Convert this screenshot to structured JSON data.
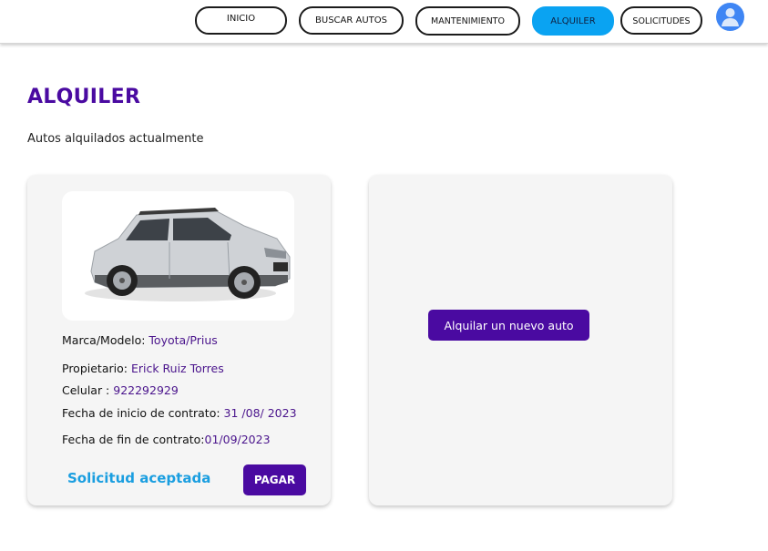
{
  "nav": {
    "items": [
      {
        "label": "INICIO"
      },
      {
        "label": "BUSCAR AUTOS"
      },
      {
        "label": "MANTENIMIENTO"
      },
      {
        "label": "ALQUILER"
      },
      {
        "label": "SOLICITUDES"
      }
    ],
    "active": "ALQUILER",
    "active_color": "#0aa3f2",
    "avatar_icon": "user-avatar-icon"
  },
  "page": {
    "title": "ALQUILER",
    "subtitle": "Autos alquilados  actualmente"
  },
  "rental": {
    "car_image": "car-photo-suv-silver",
    "brand_label": "Marca/Modelo: ",
    "brand_value": "Toyota/Prius",
    "owner_label": "Propietario: ",
    "owner_value": "Erick Ruiz Torres",
    "phone_label": "Celular : ",
    "phone_value": "922292929",
    "start_label": "Fecha de inicio de contrato: ",
    "start_value": "31 /08/ 2023",
    "end_label": "Fecha de fin de contrato:",
    "end_value": "01/09/2023",
    "status": "Solicitud aceptada",
    "pay_label": "PAGAR"
  },
  "new_rental": {
    "button_label": "Alquilar un nuevo auto"
  },
  "colors": {
    "brand": "#4a0aa1",
    "status": "#1a9ee0"
  }
}
